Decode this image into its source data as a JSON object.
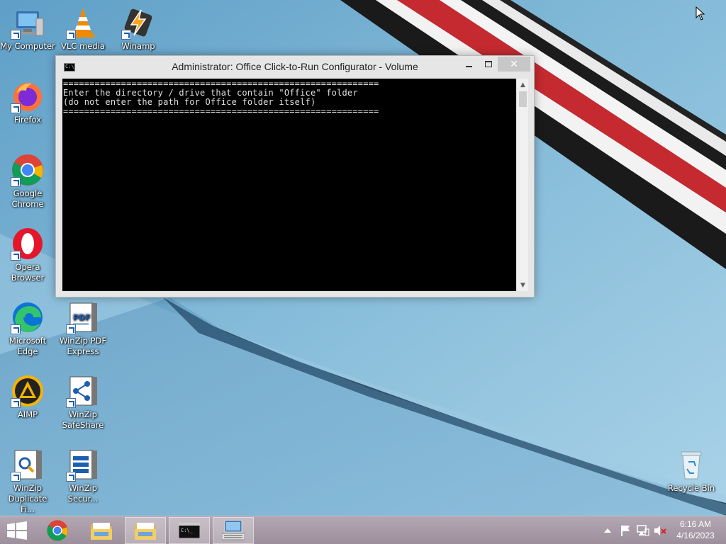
{
  "desktop": {
    "icons": [
      {
        "id": "my-computer",
        "label": "My Computer"
      },
      {
        "id": "vlc",
        "label": "VLC media"
      },
      {
        "id": "winamp",
        "label": "Winamp"
      },
      {
        "id": "firefox",
        "label": "Firefox"
      },
      {
        "id": "chrome",
        "label": "Google Chrome"
      },
      {
        "id": "opera",
        "label": "Opera Browser"
      },
      {
        "id": "edge",
        "label": "Microsoft Edge"
      },
      {
        "id": "winzip-pdf",
        "label": "WinZip PDF Express"
      },
      {
        "id": "aimp",
        "label": "AIMP"
      },
      {
        "id": "winzip-safeshare",
        "label": "WinZip SafeShare"
      },
      {
        "id": "winzip-duplicate",
        "label": "WinZip Duplicate Fi..."
      },
      {
        "id": "winzip-secure",
        "label": "WinZip Secur..."
      },
      {
        "id": "recycle-bin",
        "label": "Recycle Bin"
      }
    ]
  },
  "console": {
    "title": "Administrator:  Office Click-to-Run Configurator - Volume",
    "icon_text": "C:\\",
    "lines": [
      "============================================================",
      "Enter the directory / drive that contain \"Office\" folder",
      "(do not enter the path for Office folder itself)",
      "============================================================"
    ]
  },
  "taskbar": {
    "items": [
      "start",
      "chrome",
      "file-explorer",
      "file-explorer-2",
      "command-prompt",
      "control-panel"
    ],
    "clock": {
      "time": "6:16 AM",
      "date": "4/16/2023"
    }
  },
  "colors": {
    "wallpaper": "#7fb4d4",
    "taskbar": "#a89aa6",
    "console_bg": "#000000",
    "console_fg": "#e0e0e0"
  }
}
